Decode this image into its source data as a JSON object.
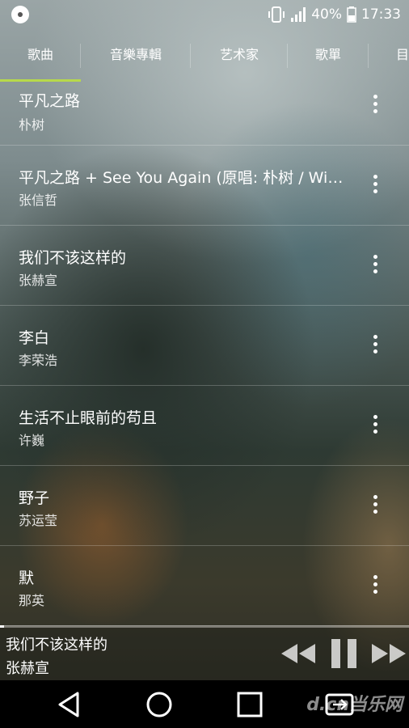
{
  "status_bar": {
    "battery_percent": "40%",
    "time": "17:33",
    "icons": [
      "vibrate-icon",
      "signal-icon",
      "battery-icon"
    ]
  },
  "tabs": [
    {
      "label": "歌曲",
      "active": true
    },
    {
      "label": "音樂專輯",
      "active": false
    },
    {
      "label": "艺术家",
      "active": false
    },
    {
      "label": "歌單",
      "active": false
    },
    {
      "label": "目",
      "active": false
    }
  ],
  "accent_color": "#b7d94b",
  "songs": [
    {
      "title": "平凡之路",
      "artist": "朴树"
    },
    {
      "title": "平凡之路 + See You Again (原唱: 朴树 / Wiz Khalifa)",
      "artist": "张信哲"
    },
    {
      "title": "我们不该这样的",
      "artist": "张赫宣"
    },
    {
      "title": "李白",
      "artist": "李荣浩"
    },
    {
      "title": "生活不止眼前的苟且",
      "artist": "许巍"
    },
    {
      "title": "野子",
      "artist": "苏运莹"
    },
    {
      "title": "默",
      "artist": "那英"
    }
  ],
  "now_playing": {
    "title": "我们不该这样的",
    "artist": "张赫宣",
    "progress": 0.01,
    "controls": [
      "rewind-icon",
      "pause-icon",
      "fast-forward-icon"
    ]
  },
  "nav_bar": {
    "buttons": [
      "back-icon",
      "home-icon",
      "recents-icon",
      "switch-sim-icon"
    ],
    "watermark": "d.cn当乐网"
  }
}
